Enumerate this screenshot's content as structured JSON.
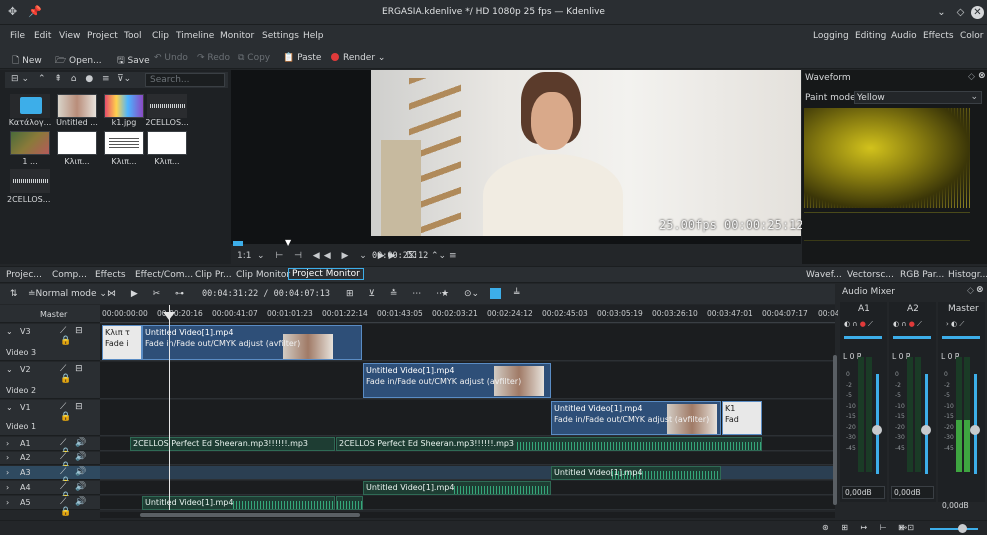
{
  "window": {
    "title": "ERGASIA.kdenlive */ HD 1080p 25 fps — Kdenlive"
  },
  "menu": [
    "File",
    "Edit",
    "View",
    "Project",
    "Tool",
    "Clip",
    "Timeline",
    "Monitor",
    "Settings",
    "Help"
  ],
  "workspaces": [
    "Logging",
    "Editing",
    "Audio",
    "Effects",
    "Color"
  ],
  "toolbar": {
    "new": "New",
    "open": "Open...",
    "save": "Save",
    "undo": "Undo",
    "redo": "Redo",
    "copy": "Copy",
    "paste": "Paste",
    "render": "Render"
  },
  "bin": {
    "search_placeholder": "Search...",
    "items": [
      {
        "label": "Κατάλογ...",
        "kind": "folder"
      },
      {
        "label": "Untitled ...",
        "kind": "video"
      },
      {
        "label": "k1.jpg",
        "kind": "image"
      },
      {
        "label": "2CELLOS...",
        "kind": "audio"
      },
      {
        "label": "1 ...",
        "kind": "video2"
      },
      {
        "label": "Κλιπ...",
        "kind": "title"
      },
      {
        "label": "Κλιπ...",
        "kind": "title"
      },
      {
        "label": "Κλιπ...",
        "kind": "title"
      },
      {
        "label": "2CELLOS...",
        "kind": "audio"
      }
    ]
  },
  "monitor": {
    "fps_overlay": "25.00fps",
    "timecode_overlay": "00:00:25:12",
    "zoom": "1:1",
    "timecode": "00:00:25:12"
  },
  "waveform": {
    "title": "Waveform",
    "paint_mode_label": "Paint mode",
    "paint_mode_value": "Yellow"
  },
  "tabs": [
    "Projec...",
    "Comp...",
    "Effects",
    "Effect/Com...",
    "Clip Pr...",
    "Clip Monitor",
    "Project Monitor"
  ],
  "scope_tabs": [
    "Wavef...",
    "Vectorsc...",
    "RGB Par...",
    "Histogr..."
  ],
  "timeline": {
    "mode": "Normal mode",
    "position": "00:04:31:22 / 00:04:07:13",
    "master_label": "Master",
    "ruler": [
      "00:00:00:00",
      "00:00:20:16",
      "00:00:41:07",
      "00:01:01:23",
      "00:01:22:14",
      "00:01:43:05",
      "00:02:03:21",
      "00:02:24:12",
      "00:02:45:03",
      "00:03:05:19",
      "00:03:26:10",
      "00:03:47:01",
      "00:04:07:17",
      "00:04"
    ],
    "tracks": [
      {
        "id": "V3",
        "name": "Video 3"
      },
      {
        "id": "V2",
        "name": "Video 2"
      },
      {
        "id": "V1",
        "name": "Video 1"
      },
      {
        "id": "A1"
      },
      {
        "id": "A2"
      },
      {
        "id": "A3"
      },
      {
        "id": "A4"
      },
      {
        "id": "A5"
      }
    ],
    "clips": {
      "v3_a_name": "Κλιπ τ",
      "v3_a_fx": "Fade i",
      "v3_b_name": "Untitled Video[1].mp4",
      "v3_b_fx": "Fade in/Fade out/CMYK adjust (avfilter)",
      "v2_name": "Untitled Video[1].mp4",
      "v2_fx": "Fade in/Fade out/CMYK adjust (avfilter)",
      "v1_name": "Untitled Video[1].mp4",
      "v1_fx": "Fade in/Fade out/CMYK adjust (avfilter)",
      "v1_b_name": "K1",
      "v1_b_fx": "Fad",
      "a1_a": "2CELLOS  Perfect  Ed Sheeran.mp3!!!!!!.mp3",
      "a1_b": "2CELLOS  Perfect  Ed Sheeran.mp3!!!!!!.mp3",
      "a3": "Untitled Video[1].mp4",
      "a4": "Untitled Video[1].mp4",
      "a5": "Untitled Video[1].mp4"
    }
  },
  "mixer": {
    "title": "Audio Mixer",
    "channels": [
      {
        "name": "A1",
        "db": "0,00dB",
        "level": 0.0
      },
      {
        "name": "A2",
        "db": "0,00dB",
        "level": 0.0
      },
      {
        "name": "Master",
        "db": "0,00dB",
        "level": 0.45
      }
    ],
    "lr": "L 0 R",
    "scale": [
      "0",
      "-2",
      "-5",
      "-10",
      "-15",
      "-20",
      "-30",
      "-45"
    ]
  }
}
